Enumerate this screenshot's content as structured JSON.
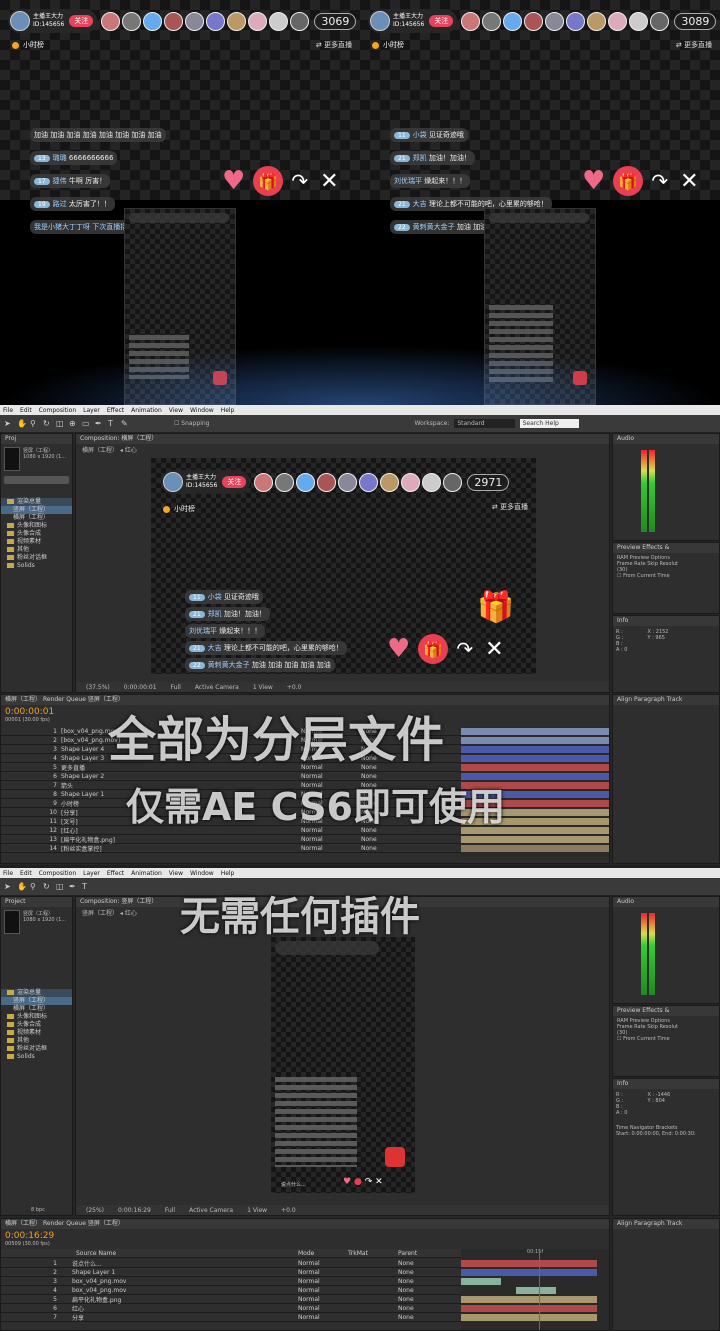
{
  "live": {
    "host_name": "主播王大力",
    "host_id": "ID:145656",
    "follow_label": "关注",
    "viewer_count_left": "3069",
    "viewer_count_right": "3089",
    "viewer_count_ae": "2971",
    "hour_rank": "小时榜",
    "more_live": "更多直播",
    "chat_left": [
      {
        "text": "加油 加油 加油 加油 加油 加油 加油 加油"
      },
      {
        "level": "13",
        "name": "璐璐",
        "text": "6666666666"
      },
      {
        "level": "17",
        "name": "捷伟",
        "text": "牛啊  厉害！"
      },
      {
        "level": "19",
        "name": "路过",
        "text": "太厉害了！！"
      },
      {
        "text": "我是小猪大丁丁呀 下次直播接会收到提醒"
      }
    ],
    "chat_right": [
      {
        "level": "11",
        "name": "小袋",
        "text": "见证奇迹哦"
      },
      {
        "level": "21",
        "name": "郑凯",
        "text": "加油！加油！"
      },
      {
        "name": "刘优瑞平",
        "text": "燥起来！！！"
      },
      {
        "level": "21",
        "name": "大吉",
        "text": "理论上都不可能的吧，心里累的够呛！"
      },
      {
        "level": "22",
        "name": "黄刺黄大金子",
        "text": "加油 加油 加油 加油 加油"
      }
    ],
    "ae_phone_caption": "说点什么...",
    "icons": {
      "heart": "heart-icon",
      "gift": "gift-icon",
      "share": "share-icon",
      "close": "close-icon"
    }
  },
  "ae1": {
    "menu": [
      "File",
      "Edit",
      "Composition",
      "Layer",
      "Effect",
      "Animation",
      "View",
      "Window",
      "Help"
    ],
    "snapping": "Snapping",
    "workspace_label": "Workspace:",
    "workspace_value": "Standard",
    "search_help": "Search Help",
    "project_tab": "Proj",
    "comp_tab": "Composition: 横屏（工程）",
    "breadcrumb_a": "横屏（工程）",
    "breadcrumb_b": "红心",
    "comp_name": "竖屏（工程）",
    "comp_dims": "1080 x 1920 (1...",
    "project_items": [
      "渲染总量",
      "竖屏（工程）",
      "横屏（工程）",
      "头像和图标",
      "头像合成",
      "视频素材",
      "其他",
      "粉丝对话框",
      "Solids"
    ],
    "zoom": "(37.5%)",
    "timecode_view": "0:00:00:01",
    "quality": "Full",
    "camera": "Active Camera",
    "views": "1 View",
    "offset": "+0.0",
    "audio_tab": "Audio",
    "preview_tab": "Preview",
    "effects_tab": "Effects &",
    "ram_options": "RAM Preview Options",
    "frame_rate": "Frame Rate",
    "skip": "Skip",
    "resolution": "Resolut",
    "fps_value": "(30)",
    "from_current": "From Current Time",
    "info_tab": "Info",
    "info_x": "X : 2152",
    "info_y": "Y : 965",
    "timeline_tab": "横屏（工程）",
    "render_queue": "Render Queue",
    "timeline_tab2": "竖屏（工程）",
    "timecode": "0:00:00:01",
    "timecode_sub": "00001 (30.00 fps)",
    "align_tab": "Align",
    "paragraph_tab": "Paragraph",
    "track_tab": "Track",
    "layers": [
      {
        "num": "1",
        "name": "[box_v04_png.mov]"
      },
      {
        "num": "2",
        "name": "[box_v04_png.mov]"
      },
      {
        "num": "3",
        "name": "Shape Layer 4"
      },
      {
        "num": "4",
        "name": "Shape Layer 3"
      },
      {
        "num": "5",
        "name": "更多直播"
      },
      {
        "num": "6",
        "name": "Shape Layer 2"
      },
      {
        "num": "7",
        "name": "箭头"
      },
      {
        "num": "8",
        "name": "Shape Layer 1"
      },
      {
        "num": "9",
        "name": "小时榜"
      },
      {
        "num": "10",
        "name": "[分享]"
      },
      {
        "num": "11",
        "name": "[叉号]"
      },
      {
        "num": "12",
        "name": "[红心]"
      },
      {
        "num": "13",
        "name": "[扁平化礼物盒.png]"
      },
      {
        "num": "14",
        "name": "[粉丝实盒掌控]"
      }
    ],
    "mode": "Normal",
    "parent": "None"
  },
  "ae2": {
    "menu": [
      "File",
      "Edit",
      "Composition",
      "Layer",
      "Effect",
      "Animation",
      "View",
      "Window",
      "Help"
    ],
    "project_tab": "Project",
    "comp_tab": "Composition: 竖屏（工程）",
    "breadcrumb_a": "竖屏（工程）",
    "breadcrumb_b": "红心",
    "comp_name": "竖屏（工程）",
    "comp_dims": "1080 x 1920 (1...",
    "project_items": [
      "渲染总量",
      "竖屏（工程）",
      "横屏（工程）",
      "头像和图标",
      "头像合成",
      "视频素材",
      "其他",
      "粉丝对话框",
      "Solids"
    ],
    "zoom": "(25%)",
    "timecode_view": "0:00:16:29",
    "quality": "Full",
    "camera": "Active Camera",
    "views": "1 View",
    "offset": "+0.0",
    "timecode": "0:00:16:29",
    "timecode_sub": "00509 (30.00 fps)",
    "bit_depth": "8 bpc",
    "info_x": "X : -1446",
    "info_y": "Y : 804",
    "time_nav": "Time Navigator Brackets",
    "time_nav_val": "Start: 0:00:00:00, End: 0:00:30:",
    "ruler_mid": "00:15f",
    "layers": [
      {
        "num": "1",
        "name": "说点什么..."
      },
      {
        "num": "2",
        "name": "Shape Layer 1"
      },
      {
        "num": "3",
        "name": "box_v04_png.mov"
      },
      {
        "num": "4",
        "name": "box_v04_png.mov"
      },
      {
        "num": "5",
        "name": "扁平化礼物盒.png"
      },
      {
        "num": "6",
        "name": "红心"
      },
      {
        "num": "7",
        "name": "分享"
      }
    ],
    "source_name": "Source Name",
    "mode_header": "Mode",
    "parent_header": "Parent",
    "trkmat": "TrkMat"
  },
  "watermark": {
    "line1": "全部为分层文件",
    "line2": "仅需AE CS6即可使用",
    "line3": "无需任何插件"
  }
}
